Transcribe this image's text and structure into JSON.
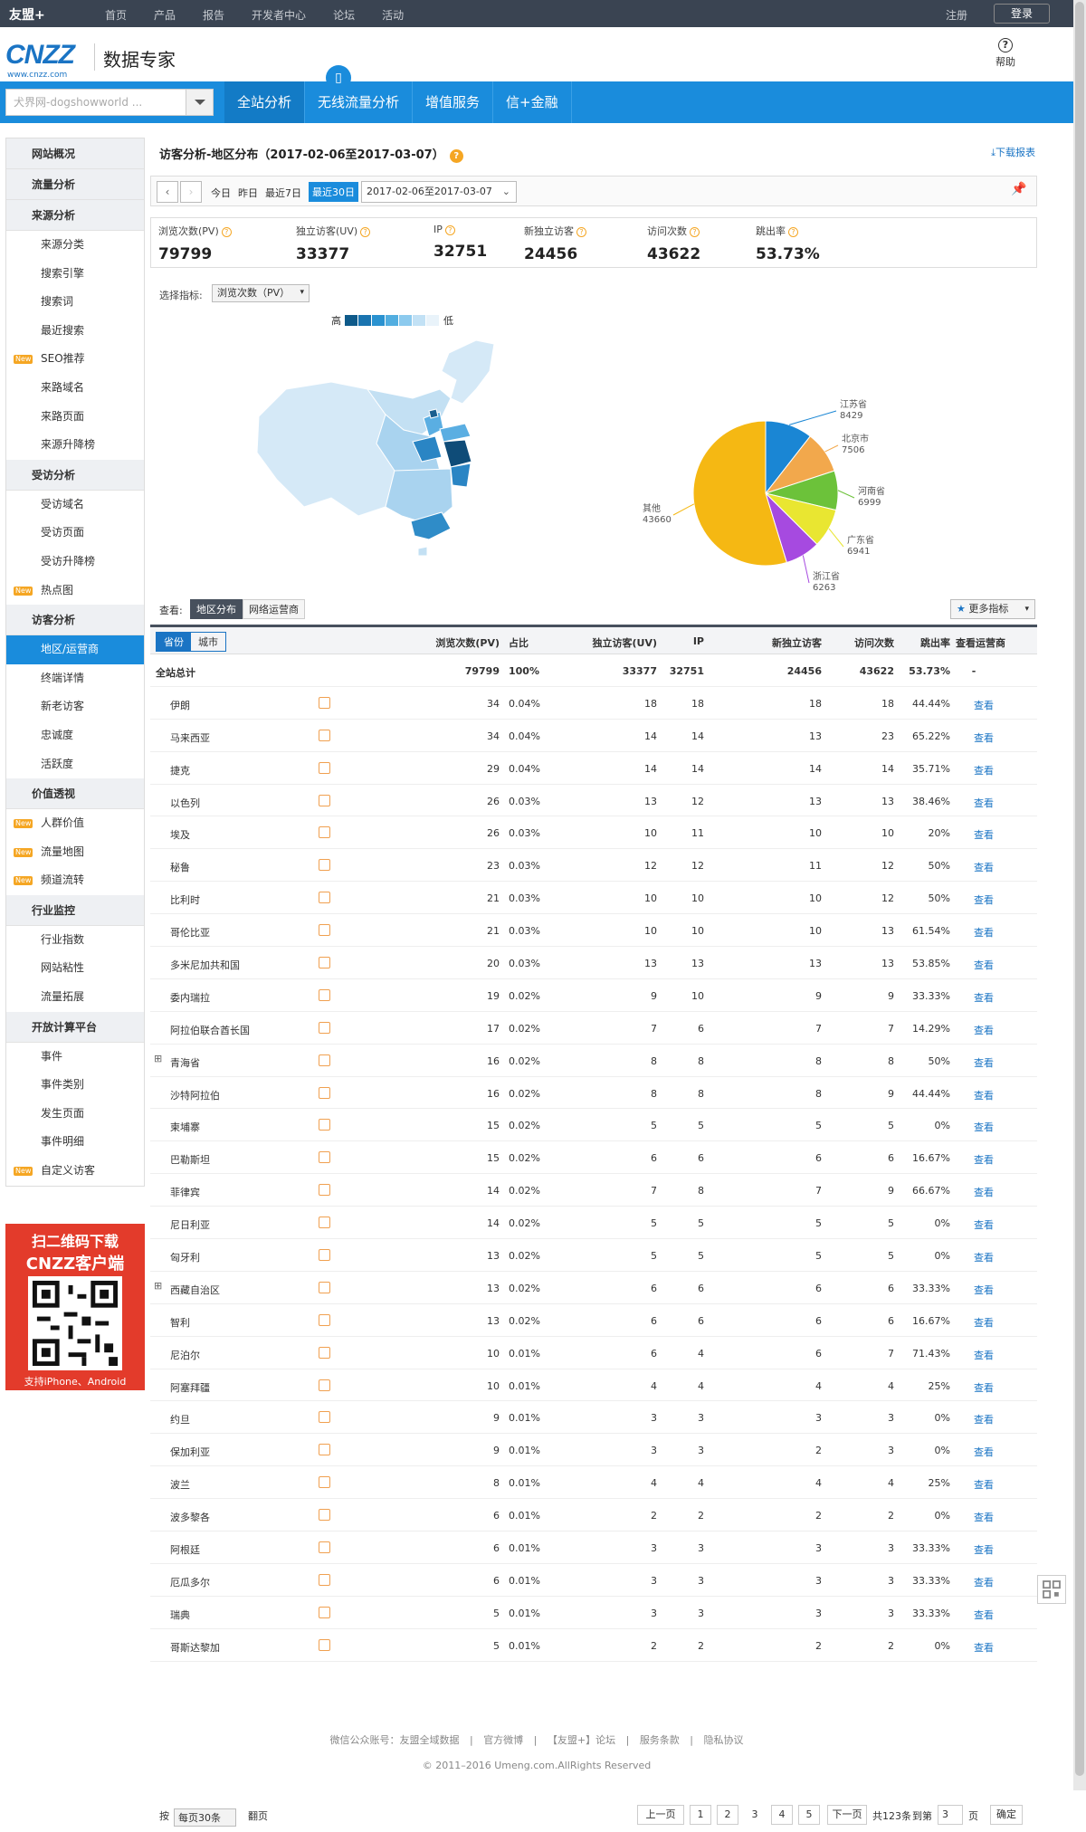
{
  "topbar": {
    "logo": "友盟+",
    "nav": [
      "首页",
      "产品",
      "报告",
      "开发者中心",
      "论坛",
      "活动"
    ],
    "register": "注册",
    "login": "登录"
  },
  "header": {
    "brand": "CNZZ",
    "brand_url": "www.cnzz.com",
    "product": "数据专家",
    "help": "帮助"
  },
  "site_select": {
    "placeholder": "犬界网-dogshowworld ..."
  },
  "main_tabs": [
    "全站分析",
    "无线流量分析",
    "增值服务",
    "信+金融"
  ],
  "sidebar": [
    {
      "section": "网站概况",
      "items": []
    },
    {
      "section": "流量分析",
      "items": []
    },
    {
      "section": "来源分析",
      "items": [
        {
          "label": "来源分类"
        },
        {
          "label": "搜索引擎"
        },
        {
          "label": "搜索词"
        },
        {
          "label": "最近搜索"
        },
        {
          "label": "SEO推荐",
          "new": true
        },
        {
          "label": "来路域名"
        },
        {
          "label": "来路页面"
        },
        {
          "label": "来源升降榜"
        }
      ]
    },
    {
      "section": "受访分析",
      "items": [
        {
          "label": "受访域名"
        },
        {
          "label": "受访页面"
        },
        {
          "label": "受访升降榜"
        },
        {
          "label": "热点图",
          "new": true
        }
      ]
    },
    {
      "section": "访客分析",
      "items": [
        {
          "label": "地区/运营商",
          "active": true
        },
        {
          "label": "终端详情"
        },
        {
          "label": "新老访客"
        },
        {
          "label": "忠诚度"
        },
        {
          "label": "活跃度"
        }
      ]
    },
    {
      "section": "价值透视",
      "items": [
        {
          "label": "人群价值",
          "new": true
        },
        {
          "label": "流量地图",
          "new": true
        },
        {
          "label": "频道流转",
          "new": true
        }
      ]
    },
    {
      "section": "行业监控",
      "items": [
        {
          "label": "行业指数"
        },
        {
          "label": "网站粘性"
        },
        {
          "label": "流量拓展"
        }
      ]
    },
    {
      "section": "开放计算平台",
      "items": [
        {
          "label": "事件"
        },
        {
          "label": "事件类别"
        },
        {
          "label": "发生页面"
        },
        {
          "label": "事件明细"
        },
        {
          "label": "自定义访客",
          "new": true
        }
      ]
    }
  ],
  "new_badge": "New",
  "qr": {
    "line1": "扫二维码下载",
    "line2": "CNZZ客户端",
    "line3": "支持iPhone、Android"
  },
  "page": {
    "title": "访客分析-地区分布（2017-02-06至2017-03-07）",
    "download": "下载报表"
  },
  "datebar": {
    "today": "今日",
    "yesterday": "昨日",
    "last7": "最近7日",
    "last30": "最近30日",
    "range": "2017-02-06至2017-03-07"
  },
  "stats": [
    {
      "label": "浏览次数(PV)",
      "value": "79799"
    },
    {
      "label": "独立访客(UV)",
      "value": "33377"
    },
    {
      "label": "IP",
      "value": "32751"
    },
    {
      "label": "新独立访客",
      "value": "24456"
    },
    {
      "label": "访问次数",
      "value": "43622"
    },
    {
      "label": "跳出率",
      "value": "53.73%"
    }
  ],
  "select_metric": {
    "label": "选择指标:",
    "value": "浏览次数（PV）"
  },
  "legend": {
    "high": "高",
    "low": "低",
    "colors": [
      "#0e5a8a",
      "#1a74b0",
      "#2a92d0",
      "#52aee0",
      "#8ccaee",
      "#c2e1f5",
      "#e9f3fa"
    ]
  },
  "pie": [
    {
      "name": "江苏省",
      "value": "8429",
      "num": 8429,
      "color": "#1a86d4"
    },
    {
      "name": "北京市",
      "value": "7506",
      "num": 7506,
      "color": "#f2a84c"
    },
    {
      "name": "河南省",
      "value": "6999",
      "num": 6999,
      "color": "#6cc23a"
    },
    {
      "name": "广东省",
      "value": "6941",
      "num": 6941,
      "color": "#e9e631"
    },
    {
      "name": "浙江省",
      "value": "6263",
      "num": 6263,
      "color": "#a64ae0"
    },
    {
      "name": "其他",
      "value": "43660",
      "num": 43660,
      "color": "#f5b813"
    }
  ],
  "view": {
    "label": "查看:",
    "tab1": "地区分布",
    "tab2": "网络运营商",
    "more": "更多指标"
  },
  "table": {
    "toggle": [
      "省份",
      "城市"
    ],
    "headers": [
      "浏览次数(PV)",
      "占比",
      "独立访客(UV)",
      "IP",
      "新独立访客",
      "访问次数",
      "跳出率",
      "查看运营商"
    ],
    "total": {
      "name": "全站总计",
      "pv": "79799",
      "pct": "100%",
      "uv": "33377",
      "ip": "32751",
      "nuv": "24456",
      "visits": "43622",
      "bounce": "53.73%",
      "op": "-"
    },
    "rows": [
      [
        "伊朗",
        "34",
        "0.04%",
        "18",
        "18",
        "18",
        "18",
        "44.44%"
      ],
      [
        "马来西亚",
        "34",
        "0.04%",
        "14",
        "14",
        "13",
        "23",
        "65.22%"
      ],
      [
        "捷克",
        "29",
        "0.04%",
        "14",
        "14",
        "14",
        "14",
        "35.71%"
      ],
      [
        "以色列",
        "26",
        "0.03%",
        "13",
        "12",
        "13",
        "13",
        "38.46%"
      ],
      [
        "埃及",
        "26",
        "0.03%",
        "10",
        "11",
        "10",
        "10",
        "20%"
      ],
      [
        "秘鲁",
        "23",
        "0.03%",
        "12",
        "12",
        "11",
        "12",
        "50%"
      ],
      [
        "比利时",
        "21",
        "0.03%",
        "10",
        "10",
        "10",
        "12",
        "50%"
      ],
      [
        "哥伦比亚",
        "21",
        "0.03%",
        "10",
        "10",
        "10",
        "13",
        "61.54%"
      ],
      [
        "多米尼加共和国",
        "20",
        "0.03%",
        "13",
        "13",
        "13",
        "13",
        "53.85%"
      ],
      [
        "委内瑞拉",
        "19",
        "0.02%",
        "9",
        "10",
        "9",
        "9",
        "33.33%"
      ],
      [
        "阿拉伯联合酋长国",
        "17",
        "0.02%",
        "7",
        "6",
        "7",
        "7",
        "14.29%"
      ],
      [
        "青海省",
        "16",
        "0.02%",
        "8",
        "8",
        "8",
        "8",
        "50%"
      ],
      [
        "沙特阿拉伯",
        "16",
        "0.02%",
        "8",
        "8",
        "8",
        "9",
        "44.44%"
      ],
      [
        "柬埔寨",
        "15",
        "0.02%",
        "5",
        "5",
        "5",
        "5",
        "0%"
      ],
      [
        "巴勒斯坦",
        "15",
        "0.02%",
        "6",
        "6",
        "6",
        "6",
        "16.67%"
      ],
      [
        "菲律宾",
        "14",
        "0.02%",
        "7",
        "8",
        "7",
        "9",
        "66.67%"
      ],
      [
        "尼日利亚",
        "14",
        "0.02%",
        "5",
        "5",
        "5",
        "5",
        "0%"
      ],
      [
        "匈牙利",
        "13",
        "0.02%",
        "5",
        "5",
        "5",
        "5",
        "0%"
      ],
      [
        "西藏自治区",
        "13",
        "0.02%",
        "6",
        "6",
        "6",
        "6",
        "33.33%"
      ],
      [
        "智利",
        "13",
        "0.02%",
        "6",
        "6",
        "6",
        "6",
        "16.67%"
      ],
      [
        "尼泊尔",
        "10",
        "0.01%",
        "6",
        "4",
        "6",
        "7",
        "71.43%"
      ],
      [
        "阿塞拜疆",
        "10",
        "0.01%",
        "4",
        "4",
        "4",
        "4",
        "25%"
      ],
      [
        "约旦",
        "9",
        "0.01%",
        "3",
        "3",
        "3",
        "3",
        "0%"
      ],
      [
        "保加利亚",
        "9",
        "0.01%",
        "3",
        "3",
        "2",
        "3",
        "0%"
      ],
      [
        "波兰",
        "8",
        "0.01%",
        "4",
        "4",
        "4",
        "4",
        "25%"
      ],
      [
        "波多黎各",
        "6",
        "0.01%",
        "2",
        "2",
        "2",
        "2",
        "0%"
      ],
      [
        "阿根廷",
        "6",
        "0.01%",
        "3",
        "3",
        "3",
        "3",
        "33.33%"
      ],
      [
        "厄瓜多尔",
        "6",
        "0.01%",
        "3",
        "3",
        "3",
        "3",
        "33.33%"
      ],
      [
        "瑞典",
        "5",
        "0.01%",
        "3",
        "3",
        "3",
        "3",
        "33.33%"
      ],
      [
        "哥斯达黎加",
        "5",
        "0.01%",
        "2",
        "2",
        "2",
        "2",
        "0%"
      ]
    ],
    "expandable": [
      "青海省",
      "西藏自治区"
    ],
    "view_link": "查看"
  },
  "pager": {
    "by": "按",
    "per_page": "每页30条",
    "turn": "翻页",
    "prev": "上一页",
    "pages": [
      "1",
      "2",
      "3",
      "4",
      "5"
    ],
    "current": "3",
    "next": "下一页",
    "total": "共123条",
    "goto": "到第",
    "goto_value": "3",
    "page_unit": "页",
    "confirm": "确定"
  },
  "footer": {
    "links": [
      "微信公众账号：友盟全域数据",
      "官方微博",
      "【友盟+】论坛",
      "服务条款",
      "隐私协议"
    ],
    "copyright": "© 2011–2016 Umeng.com.AllRights Reserved"
  }
}
